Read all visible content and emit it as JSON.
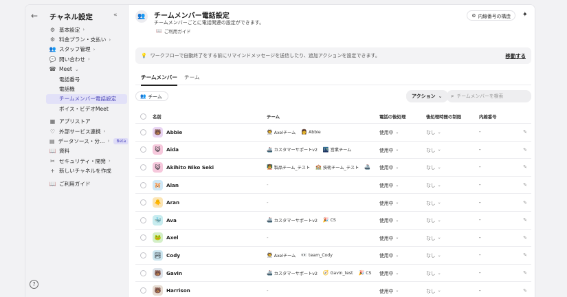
{
  "sidebar": {
    "title": "チャネル設定",
    "items": [
      {
        "label": "基本設定",
        "icon": "gear-icon",
        "chev": "›"
      },
      {
        "label": "料金プラン・支払い",
        "icon": "gear-icon",
        "chev": "›"
      },
      {
        "label": "スタッフ管理",
        "icon": "users-icon",
        "chev": "›"
      },
      {
        "label": "問い合わせ",
        "icon": "chat-icon",
        "chev": "›"
      },
      {
        "label": "Meet",
        "icon": "phone-icon",
        "chev": "⌄"
      }
    ],
    "meet_sub": [
      "電話番号",
      "電話機",
      "チームメンバー電話設定",
      "ボイス・ビデオMeet"
    ],
    "items2": [
      {
        "label": "アプリストア",
        "icon": "grid-icon",
        "chev": ""
      },
      {
        "label": "外部サービス連携",
        "icon": "link-icon",
        "chev": "›"
      },
      {
        "label": "データソース・分…",
        "icon": "database-icon",
        "chev": "›",
        "badge": "Beta"
      },
      {
        "label": "資料",
        "icon": "book-icon",
        "chev": ""
      },
      {
        "label": "セキュリティ・開発",
        "icon": "tools-icon",
        "chev": "›"
      },
      {
        "label": "新しいチャネルを作成",
        "icon": "plus-icon",
        "chev": ""
      }
    ],
    "guide": "ご利用ガイド"
  },
  "header": {
    "title": "チームメンバー電話設定",
    "subtitle": "チームメンバーごとに電話関連の設定ができます。",
    "guide": "ご利用ガイド",
    "ext_button": "内線番号の構造"
  },
  "banner": {
    "text": "ワークフローで自動終了をする前にリマインドメッセージを送信したり、追加アクションを設定できます。",
    "link": "移動する"
  },
  "tabs": [
    "チームメンバー",
    "チーム"
  ],
  "filter": {
    "team_chip": "チーム",
    "action": "アクション",
    "search_placeholder": "チームメンバーを検索"
  },
  "table": {
    "headers": [
      "名前",
      "チーム",
      "電話の後処理",
      "後処理時間の制限",
      "内線番号"
    ],
    "rows": [
      {
        "name": "Abbie",
        "avatar": "🐻",
        "avbg": "#e9d5f3",
        "teams": [
          {
            "em": "🧑‍🚀",
            "t": "Axelチーム"
          },
          {
            "em": "👩",
            "t": "Abbie"
          }
        ],
        "status": "使用中",
        "limit": "なし",
        "ext": "-"
      },
      {
        "name": "Aida",
        "avatar": "😺",
        "avbg": "#f6c8dc",
        "teams": [
          {
            "em": "🚢",
            "t": "カスタマーサポートv2"
          },
          {
            "em": "🌃",
            "t": "営業チーム"
          }
        ],
        "status": "使用中",
        "limit": "なし",
        "ext": "-"
      },
      {
        "name": "Akihito Niko Seki",
        "avatar": "😺",
        "avbg": "#f6c8dc",
        "teams": [
          {
            "em": "🧑‍🏫",
            "t": "製品チーム_テスト"
          },
          {
            "em": "🏫",
            "t": "技術チーム_テスト"
          },
          {
            "em": "🚢",
            "t": ""
          }
        ],
        "status": "使用中",
        "limit": "なし",
        "ext": "-"
      },
      {
        "name": "Alan",
        "avatar": "🐹",
        "avbg": "#cfe8f7",
        "teams": [],
        "status": "使用中",
        "limit": "なし",
        "ext": "-"
      },
      {
        "name": "Aran",
        "avatar": "🐥",
        "avbg": "#fbe5b5",
        "teams": [],
        "status": "使用中",
        "limit": "なし",
        "ext": "-"
      },
      {
        "name": "Ava",
        "avatar": "🐳",
        "avbg": "#c7ecef",
        "teams": [
          {
            "em": "🚢",
            "t": "カスタマーサポートv2"
          },
          {
            "em": "🎉",
            "t": "CS"
          }
        ],
        "status": "使用中",
        "limit": "なし",
        "ext": "-"
      },
      {
        "name": "Axel",
        "avatar": "🐸",
        "avbg": "#d4efc9",
        "teams": [],
        "status": "使用中",
        "limit": "なし",
        "ext": "-"
      },
      {
        "name": "Cody",
        "avatar": "🏞",
        "avbg": "#cce6f0",
        "teams": [
          {
            "em": "🧑‍🚀",
            "t": "Axelチーム"
          },
          {
            "em": "👀",
            "t": "team_Cody"
          }
        ],
        "status": "使用中",
        "limit": "なし",
        "ext": "-"
      },
      {
        "name": "Gavin",
        "avatar": "🐻",
        "avbg": "#dde3ea",
        "teams": [
          {
            "em": "🚢",
            "t": "カスタマーサポートv2"
          },
          {
            "em": "🧭",
            "t": "Gavin_test"
          },
          {
            "em": "🎉",
            "t": "CS"
          }
        ],
        "status": "使用中",
        "limit": "なし",
        "ext": "-"
      },
      {
        "name": "Harrison",
        "avatar": "🐻",
        "avbg": "#e7dcd2",
        "teams": [],
        "status": "使用中",
        "limit": "なし",
        "ext": "-"
      }
    ]
  }
}
